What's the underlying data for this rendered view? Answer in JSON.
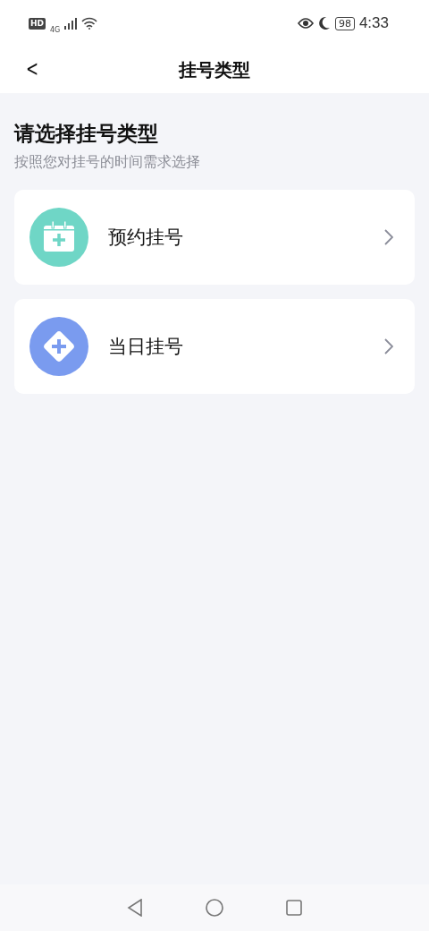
{
  "status_bar": {
    "hd": "HD",
    "network": "4G",
    "battery": "98",
    "time": "4:33"
  },
  "header": {
    "back": "<",
    "title": "挂号类型"
  },
  "intro": {
    "heading": "请选择挂号类型",
    "subtitle": "按照您对挂号的时间需求选择"
  },
  "options": [
    {
      "kind": "calendar",
      "label": "预约挂号",
      "color": "#6fd6c6"
    },
    {
      "kind": "diamond",
      "label": "当日挂号",
      "color": "#7a9bef"
    }
  ]
}
